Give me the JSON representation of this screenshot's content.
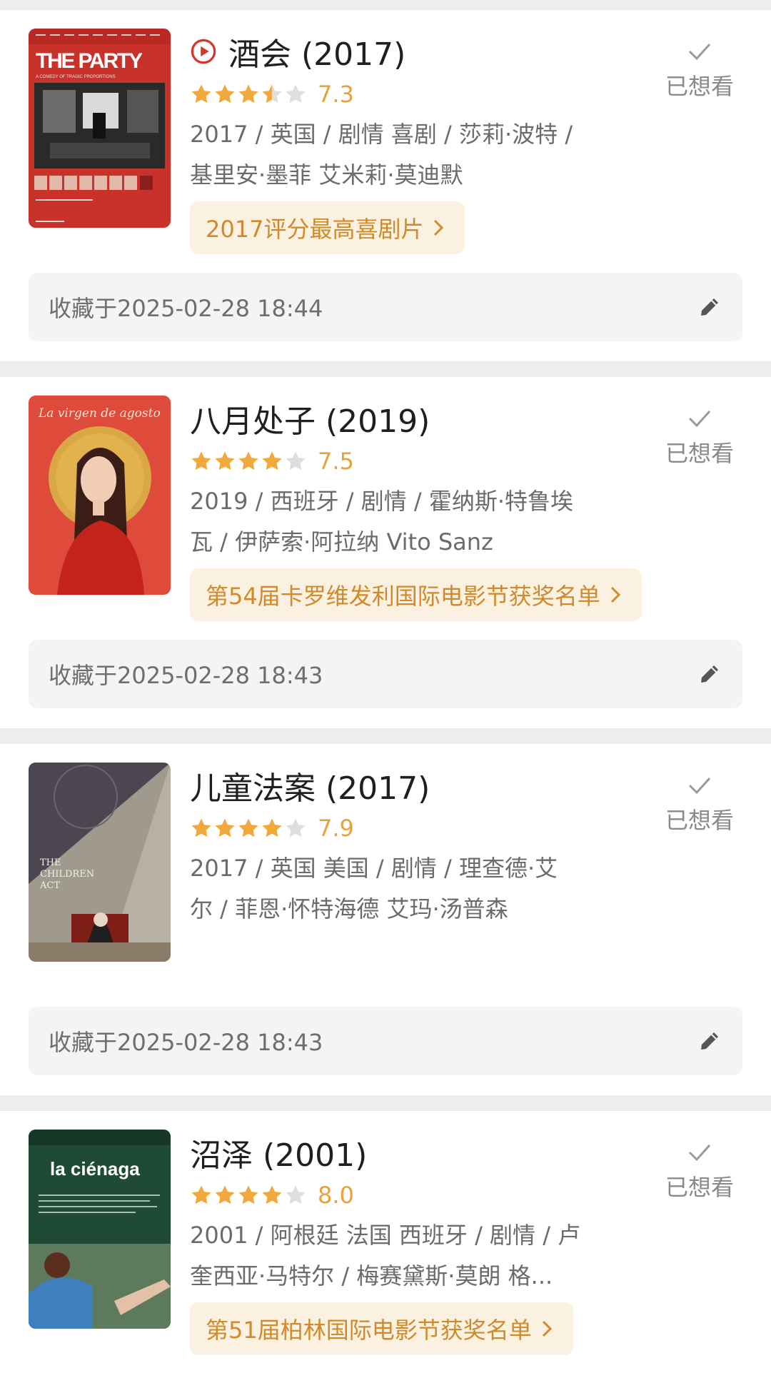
{
  "colors": {
    "star_filled": "#f2a93b",
    "star_empty": "#dedede",
    "score": "#e9a23b",
    "tag_bg": "#fbf1e1",
    "tag_text": "#d08a2c",
    "play_icon": "#d8352a"
  },
  "movies": [
    {
      "title": "酒会 (2017)",
      "has_play_icon": true,
      "rating": 3.5,
      "score": "7.3",
      "meta_lines": [
        "2017 / 英国 / 剧情 喜剧 / 莎莉·波特 /",
        "基里安·墨菲 艾米莉·莫迪默"
      ],
      "tag": "2017评分最高喜剧片",
      "status": "已想看",
      "status_icon": "checkmark-icon",
      "collected": "收藏于2025-02-28 18:44",
      "edit_icon": "pencil-icon",
      "poster": {
        "style": "red-party",
        "title_text": "THE PARTY",
        "small_text": "A COMEDY OF TRAGIC PROPORTIONS"
      }
    },
    {
      "title": "八月处子 (2019)",
      "has_play_icon": false,
      "rating": 4,
      "score": "7.5",
      "meta_lines": [
        "2019 / 西班牙 / 剧情 / 霍纳斯·特鲁埃",
        "瓦 / 伊萨索·阿拉纳 Vito Sanz"
      ],
      "tag": "第54届卡罗维发利国际电影节获奖名单",
      "status": "已想看",
      "status_icon": "checkmark-icon",
      "collected": "收藏于2025-02-28 18:43",
      "edit_icon": "pencil-icon",
      "poster": {
        "style": "red-portrait",
        "title_text": "La virgen de agosto"
      }
    },
    {
      "title": "儿童法案 (2017)",
      "has_play_icon": false,
      "rating": 4,
      "score": "7.9",
      "meta_lines": [
        "2017 / 英国 美国 / 剧情 / 理查德·艾",
        "尔 / 菲恩·怀特海德 艾玛·汤普森"
      ],
      "tag": "",
      "status": "已想看",
      "status_icon": "checkmark-icon",
      "collected": "收藏于2025-02-28 18:43",
      "edit_icon": "pencil-icon",
      "poster": {
        "style": "grey-court",
        "title_text": "THE CHILDREN ACT"
      }
    },
    {
      "title": "沼泽 (2001)",
      "has_play_icon": false,
      "rating": 4,
      "score": "8.0",
      "meta_lines": [
        "2001 / 阿根廷 法国 西班牙 / 剧情 / 卢",
        "奎西亚·马特尔 / 梅赛黛斯·莫朗 格..."
      ],
      "tag": "第51届柏林国际电影节获奖名单",
      "status": "已想看",
      "status_icon": "checkmark-icon",
      "collected": "",
      "edit_icon": "pencil-icon",
      "poster": {
        "style": "green-pool",
        "title_text": "la ciénaga"
      }
    }
  ]
}
